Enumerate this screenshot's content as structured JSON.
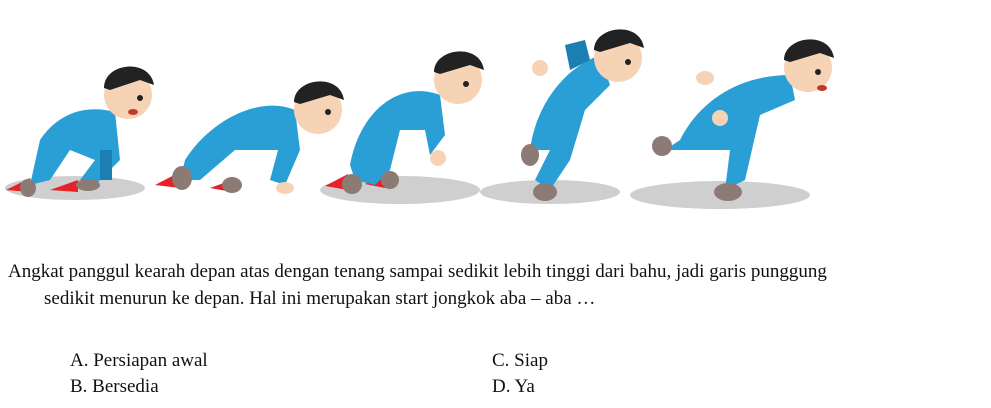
{
  "figure": {
    "colors": {
      "suit": "#2a9fd6",
      "suit_dark": "#1b7fb3",
      "skin": "#f7d3b5",
      "hair": "#222222",
      "shoe": "#8c7b75",
      "marker": "#e8202a",
      "shadow": "#cfcfcf"
    }
  },
  "question": {
    "line1": "Angkat panggul kearah depan atas dengan tenang sampai sedikit lebih tinggi dari bahu, jadi garis punggung",
    "line2": "sedikit menurun ke depan. Hal ini merupakan start jongkok  aba – aba …"
  },
  "options": {
    "a": "A. Persiapan awal",
    "b": "B. Bersedia",
    "c": "C. Siap",
    "d": "D. Ya"
  }
}
